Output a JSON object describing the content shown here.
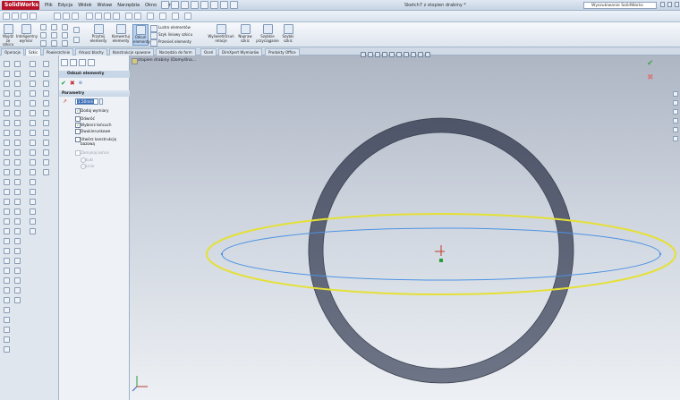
{
  "app": {
    "logo": "SolidWorks",
    "title": "Sketch7 z stopien drabiny *"
  },
  "menu": [
    "Plik",
    "Edycja",
    "Widok",
    "Wstaw",
    "Narzędzia",
    "Okno",
    "Pomoc"
  ],
  "search": {
    "placeholder": "Wyszukiwanie SolidWorks"
  },
  "commands": {
    "exit_sketch": "Wyjdź ze szkicu",
    "smart_dim": "Inteligentny wymiar",
    "trim": "Przytnij elementy",
    "convert": "Konwertuj elementy",
    "offset": "Odsuń elementy",
    "mirror": "Lustro elementów",
    "linear_pattern": "Szyk liniowy szkicu",
    "move": "Przenieś elementy",
    "relations": "Wyświetl/Usuń relacje",
    "repair": "Napraw szkic",
    "quick_snaps": "Szybkie przyciąganie",
    "rapid_sketch": "Szybki szkic"
  },
  "tabs": [
    "Operacje",
    "Szkic",
    "Powierzchnie",
    "Arkusz blachy",
    "Konstrukcje spawane",
    "Narzędzia do form",
    "Oceń",
    "DimXpert Wymiarów",
    "Produkty Office"
  ],
  "active_tab": "Szkic",
  "property_manager": {
    "title": "Odsuń elementy",
    "group": "Parametry",
    "distance": "1.50mm",
    "options": [
      {
        "label": "Dodaj wymiary",
        "checked": true,
        "enabled": true
      },
      {
        "label": "Odwróć",
        "checked": false,
        "enabled": true
      },
      {
        "label": "Wybierz łańcuch",
        "checked": true,
        "enabled": true
      },
      {
        "label": "Dwukierunkowe",
        "checked": false,
        "enabled": true
      },
      {
        "label": "Utwórz konstrukcję bazową",
        "checked": false,
        "enabled": true
      },
      {
        "label": "Zamykaj końce",
        "checked": false,
        "enabled": false
      }
    ],
    "cap_options": [
      "Łuki",
      "Linie"
    ]
  },
  "viewport": {
    "breadcrumb": "stopien drabiny  (Domyślna...",
    "ring_color": "#5a6275",
    "preview_color": "#e9e43a",
    "sketch_color": "#4a90e0"
  }
}
